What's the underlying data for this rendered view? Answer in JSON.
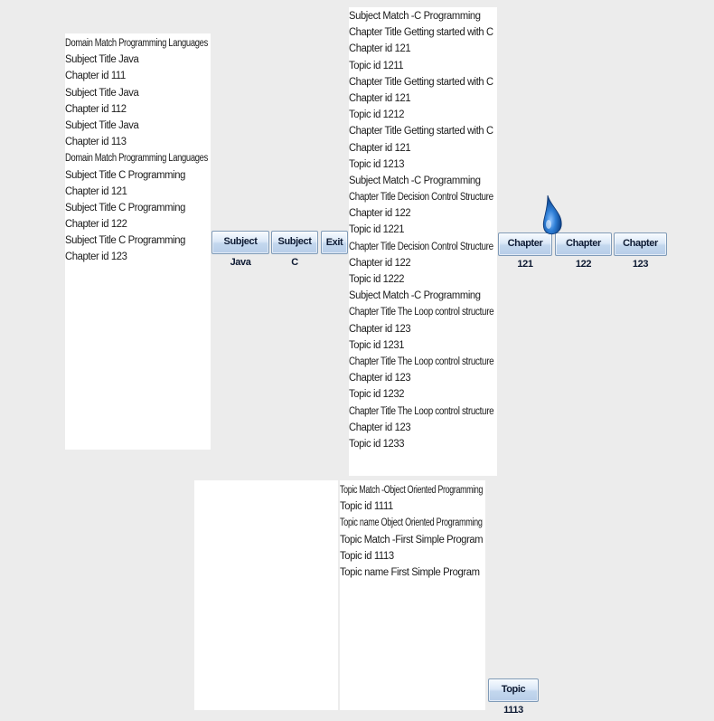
{
  "domain_panel": {
    "lines": [
      " Domain Match  Programming Languages",
      " Subject Title  Java",
      "Chapter id  111",
      " Subject Title  Java",
      "Chapter id  112",
      " Subject Title  Java",
      "Chapter id  113",
      "Domain Match  Programming Languages",
      " Subject Title  C Programming",
      "Chapter id  121",
      " Subject Title  C Programming",
      "Chapter id  122",
      " Subject Title  C Programming",
      "Chapter id  123"
    ]
  },
  "subject_buttons": {
    "java": "Subject Java",
    "c": "Subject C",
    "exit": "Exit"
  },
  "chapter_panel": {
    "lines": [
      " Subject Match -C Programming",
      "Chapter Title Getting started with C",
      "Chapter id 121",
      "Topic id 1211",
      "Chapter Title Getting started with C",
      "Chapter id 121",
      "Topic id 1212",
      "Chapter Title Getting started with C",
      "Chapter id 121",
      "Topic id 1213",
      "Subject Match -C Programming",
      "Chapter Title Decision Control Structure",
      "Chapter id 122",
      "Topic id 1221",
      "Chapter Title Decision Control Structure",
      "Chapter id 122",
      "Topic id 1222",
      "Subject Match -C Programming",
      "Chapter Title The Loop control structure",
      "Chapter id 123",
      "Topic id 1231",
      "Chapter Title The Loop control structure",
      "Chapter id 123",
      "Topic id 1232",
      "Chapter Title The Loop control structure",
      "Chapter id 123",
      "Topic id 1233"
    ]
  },
  "chapter_buttons": {
    "c121": "Chapter 121",
    "c122": "Chapter 122",
    "c123": "Chapter 123"
  },
  "topic_panel": {
    "lines": [
      " Topic Match -Object Oriented Programming",
      "Topic id 1111",
      "Topic name Object Oriented Programming",
      "Topic Match -First Simple Program",
      "Topic id 1113",
      "Topic name First Simple Program"
    ]
  },
  "topic_buttons": {
    "t1113": "Topic 1113"
  },
  "colors": {
    "background": "#ececec",
    "panel": "#ffffff",
    "button_border": "#7f9ab7",
    "cursor": "#1a64b8"
  },
  "icons": {
    "cursor": "water-drop-cursor-icon"
  }
}
